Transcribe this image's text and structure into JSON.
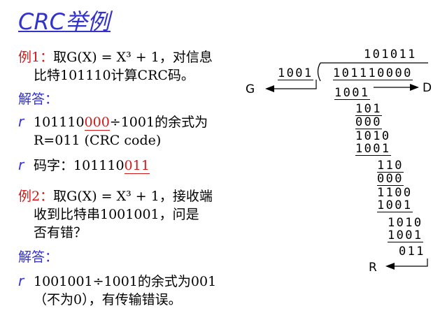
{
  "title": "CRC举例",
  "example1": {
    "prefix": "例1：",
    "line1": "取G(X) = X³ + 1，对信息",
    "line2": "比特101110计算CRC码。"
  },
  "answer_label_1": "解答：",
  "answer1": {
    "bullet": "r",
    "dividend_a": "101110",
    "dividend_b": "000",
    "rest": "÷1001的余式为",
    "line2": "R=011 (CRC code)"
  },
  "answer1b": {
    "bullet": "r",
    "label": "码字：",
    "code_a": "101110",
    "code_b": "011"
  },
  "example2": {
    "prefix": "例2：",
    "line1": "取G(X) = X³ + 1，接收端",
    "line2": "收到比特串1001001，问是",
    "line3": "否有错？"
  },
  "answer_label_2": "解答：",
  "answer2": {
    "bullet": "r",
    "line1": "1001001÷1001的余式为001",
    "line2": "（不为0），有传输错误。"
  },
  "division": {
    "quotient": "101011",
    "divisor": "1001",
    "dividend": "101110000",
    "label_g": "G",
    "label_d": "D",
    "label_r": "R",
    "steps": [
      "1001",
      "101",
      "000",
      "1010",
      "1001",
      "110",
      "000",
      "1100",
      "1001",
      "1010",
      "1001",
      "011"
    ]
  },
  "colors": {
    "title": "#3333cc",
    "highlight": "#d01818",
    "bullet": "#3333cc"
  }
}
